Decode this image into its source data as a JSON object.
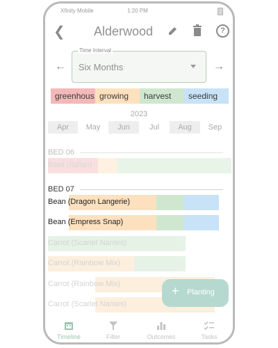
{
  "status_bar": {
    "carrier": "Xfinity Mobile",
    "time": "1:20 PM"
  },
  "app_bar": {
    "title": "Alderwood"
  },
  "interval": {
    "label": "Time Interval",
    "value": "Six Months"
  },
  "legend": [
    {
      "label": "greenhous",
      "color": "#f3b9b9"
    },
    {
      "label": "growing",
      "color": "#fde1bf"
    },
    {
      "label": "harvest",
      "color": "#cfe7cf"
    },
    {
      "label": "seeding",
      "color": "#c8e2f7"
    }
  ],
  "timeline": {
    "year": "2023",
    "months": [
      "Apr",
      "May",
      "Jun",
      "Jul",
      "Aug",
      "Sep"
    ]
  },
  "beds": [
    {
      "name": "BED 06",
      "plantings": [
        {
          "name": "Basil (Italian)"
        }
      ]
    },
    {
      "name": "BED 07",
      "plantings": [
        {
          "name": "Bean (Dragon Langerie)"
        },
        {
          "name": "Bean (Empress Snap)"
        },
        {
          "name": "Carrot (Scarlet Nantes)"
        },
        {
          "name": "Carrot (Rainbow Mix)"
        },
        {
          "name": "Carrot (Rainbow Mix)"
        },
        {
          "name": "Carrot (Scarlet Nantes)"
        }
      ]
    }
  ],
  "fab": {
    "label": "Planting",
    "icon": "plus-icon"
  },
  "bottom_nav": [
    {
      "label": "Timeline",
      "icon": "calendar-icon",
      "active": true
    },
    {
      "label": "Filter",
      "icon": "filter-icon",
      "active": false
    },
    {
      "label": "Outcomes",
      "icon": "bar-chart-icon",
      "active": false
    },
    {
      "label": "Tasks",
      "icon": "checklist-icon",
      "active": false
    }
  ]
}
